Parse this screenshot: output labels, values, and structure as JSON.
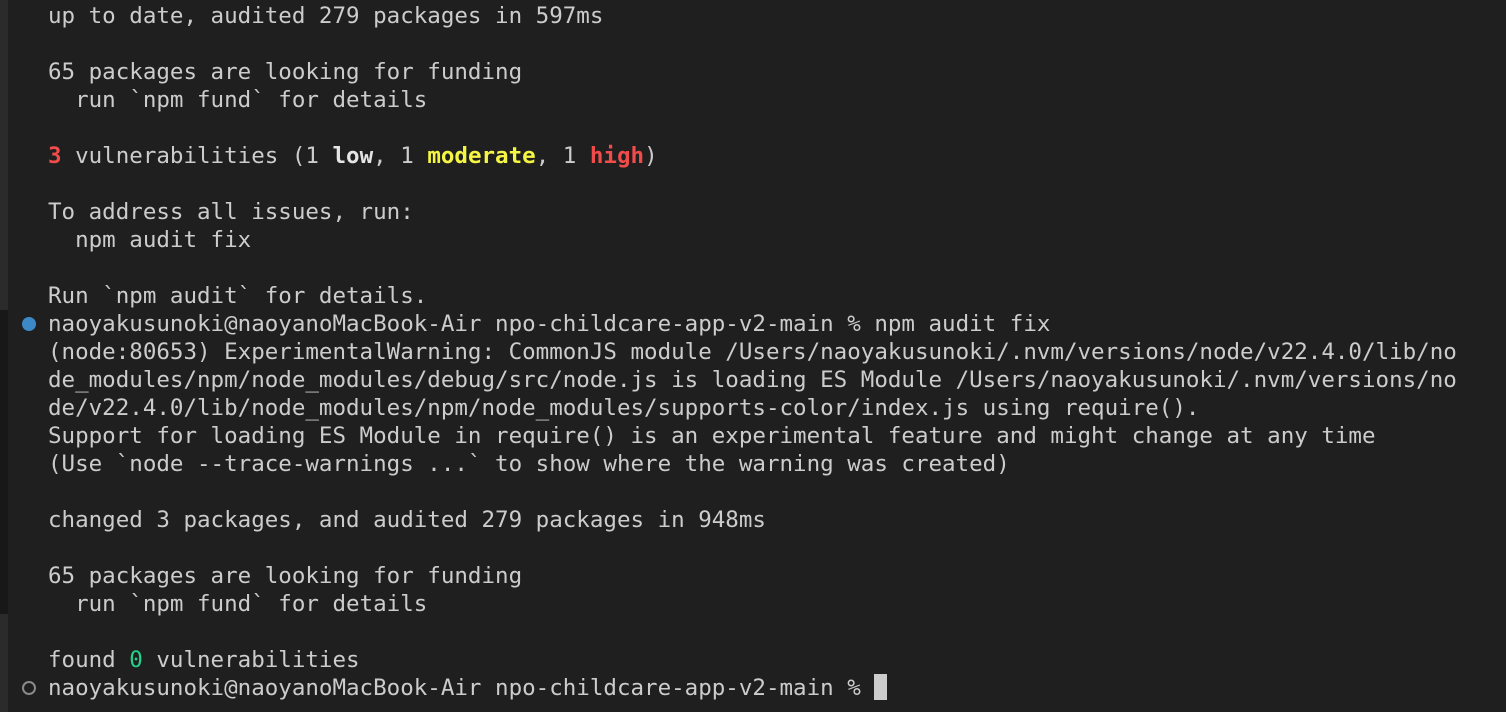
{
  "terminal": {
    "line1": "up to date, audited 279 packages in 597ms",
    "line3": "65 packages are looking for funding",
    "line4": "  run `npm fund` for details",
    "vuln": {
      "count": "3",
      "text_a": " vulnerabilities (1 ",
      "low": "low",
      "text_b": ", 1 ",
      "moderate": "moderate",
      "text_c": ", 1 ",
      "high": "high",
      "text_d": ")"
    },
    "line8": "To address all issues, run:",
    "line9": "  npm audit fix",
    "line11": "Run `npm audit` for details.",
    "prompt1": "naoyakusunoki@naoyanoMacBook-Air npo-childcare-app-v2-main % npm audit fix",
    "warn1": "(node:80653) ExperimentalWarning: CommonJS module /Users/naoyakusunoki/.nvm/versions/node/v22.4.0/lib/no",
    "warn2": "de_modules/npm/node_modules/debug/src/node.js is loading ES Module /Users/naoyakusunoki/.nvm/versions/no",
    "warn3": "de/v22.4.0/lib/node_modules/npm/node_modules/supports-color/index.js using require().",
    "warn4": "Support for loading ES Module in require() is an experimental feature and might change at any time",
    "warn5": "(Use `node --trace-warnings ...` to show where the warning was created)",
    "line19": "changed 3 packages, and audited 279 packages in 948ms",
    "line21": "65 packages are looking for funding",
    "line22": "  run `npm fund` for details",
    "found": {
      "text_a": "found ",
      "count": "0",
      "text_b": " vulnerabilities"
    },
    "prompt2": "naoyakusunoki@naoyanoMacBook-Air npo-childcare-app-v2-main % "
  },
  "colors": {
    "background": "#1f1f1f",
    "text": "#cccccc",
    "red": "#f14c4c",
    "yellow": "#f5f543",
    "green": "#23d18b",
    "marker_blue": "#3d88c7"
  }
}
